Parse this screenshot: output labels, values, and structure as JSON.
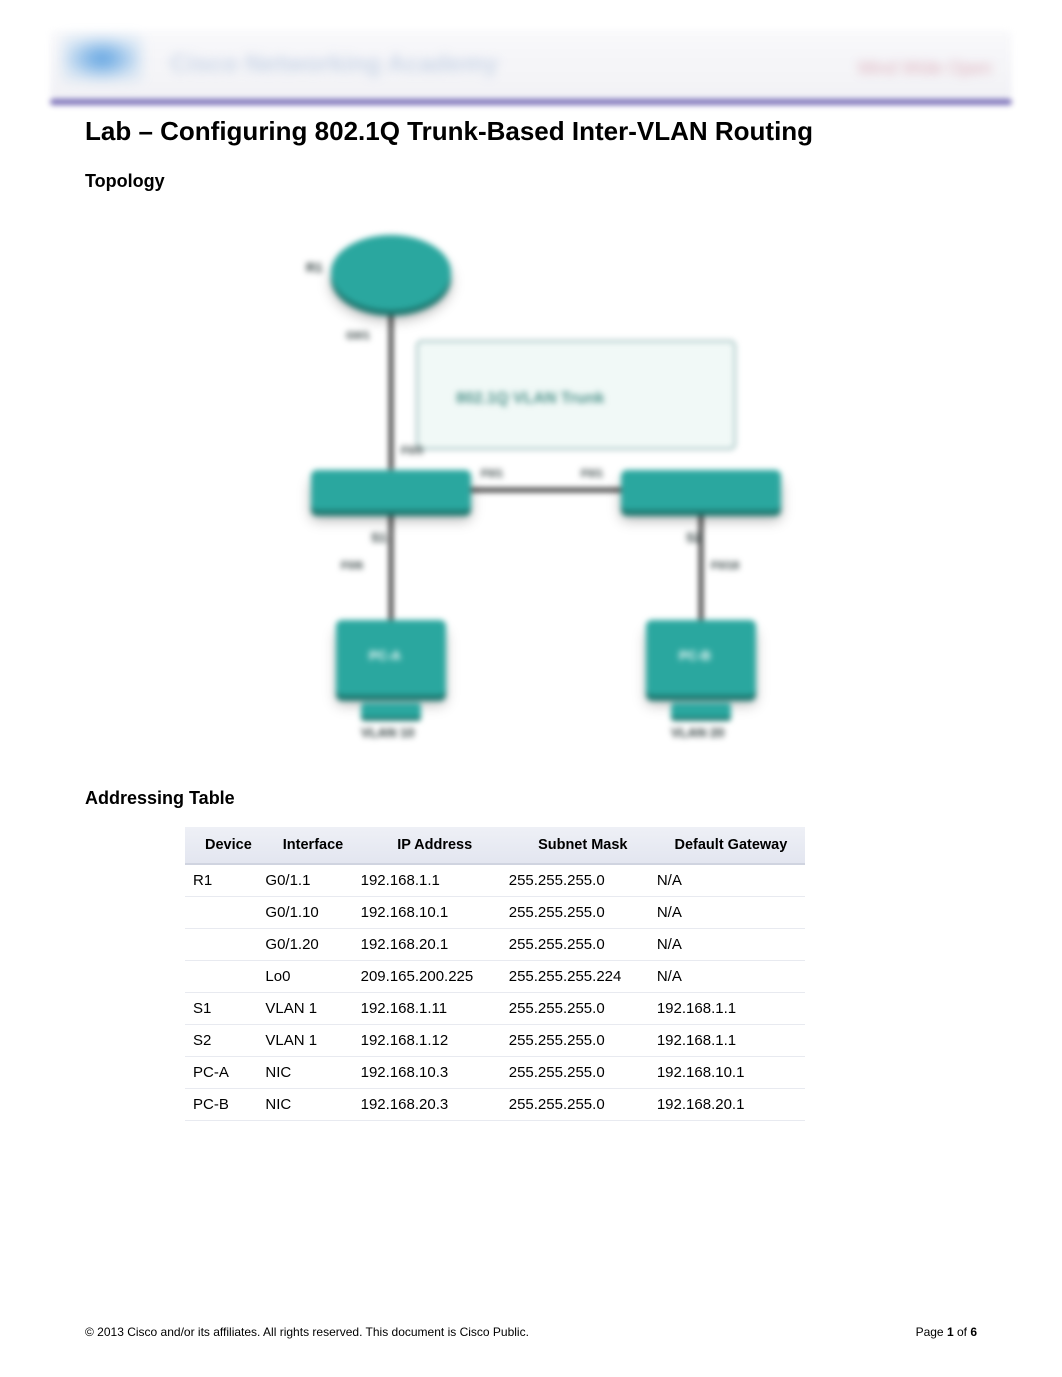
{
  "header": {
    "brand": "Cisco Networking Academy",
    "motto": "Mind Wide Open"
  },
  "title": "Lab – Configuring 802.1Q Trunk-Based Inter-VLAN Routing",
  "section_topology": "Topology",
  "section_addressing": "Addressing Table",
  "topology": {
    "devices": {
      "router": "R1",
      "switch1": "S1",
      "switch2": "S2",
      "pc_a": "PC-A",
      "pc_b": "PC-B"
    },
    "link_label": "802.1Q VLAN Trunk",
    "ports": {
      "r1_down": "G0/1",
      "s1_up": "F0/5",
      "s1_right": "F0/1",
      "s2_left": "F0/1",
      "s1_down": "F0/6",
      "s2_down": "F0/18"
    },
    "vlans": {
      "left": "VLAN 10",
      "right": "VLAN 20"
    }
  },
  "table": {
    "headers": {
      "device": "Device",
      "interface": "Interface",
      "ip": "IP Address",
      "mask": "Subnet Mask",
      "gateway": "Default Gateway"
    },
    "rows": [
      {
        "device": "R1",
        "interface": "G0/1.1",
        "ip": "192.168.1.1",
        "mask": "255.255.255.0",
        "gateway": "N/A"
      },
      {
        "device": "",
        "interface": "G0/1.10",
        "ip": "192.168.10.1",
        "mask": "255.255.255.0",
        "gateway": "N/A"
      },
      {
        "device": "",
        "interface": "G0/1.20",
        "ip": "192.168.20.1",
        "mask": "255.255.255.0",
        "gateway": "N/A"
      },
      {
        "device": "",
        "interface": "Lo0",
        "ip": "209.165.200.225",
        "mask": "255.255.255.224",
        "gateway": "N/A"
      },
      {
        "device": "S1",
        "interface": "VLAN 1",
        "ip": "192.168.1.11",
        "mask": "255.255.255.0",
        "gateway": "192.168.1.1"
      },
      {
        "device": "S2",
        "interface": "VLAN 1",
        "ip": "192.168.1.12",
        "mask": "255.255.255.0",
        "gateway": "192.168.1.1"
      },
      {
        "device": "PC-A",
        "interface": "NIC",
        "ip": "192.168.10.3",
        "mask": "255.255.255.0",
        "gateway": "192.168.10.1"
      },
      {
        "device": "PC-B",
        "interface": "NIC",
        "ip": "192.168.20.3",
        "mask": "255.255.255.0",
        "gateway": "192.168.20.1"
      }
    ]
  },
  "chart_data": {
    "type": "table",
    "title": "Addressing Table",
    "columns": [
      "Device",
      "Interface",
      "IP Address",
      "Subnet Mask",
      "Default Gateway"
    ],
    "rows": [
      [
        "R1",
        "G0/1.1",
        "192.168.1.1",
        "255.255.255.0",
        "N/A"
      ],
      [
        "R1",
        "G0/1.10",
        "192.168.10.1",
        "255.255.255.0",
        "N/A"
      ],
      [
        "R1",
        "G0/1.20",
        "192.168.20.1",
        "255.255.255.0",
        "N/A"
      ],
      [
        "R1",
        "Lo0",
        "209.165.200.225",
        "255.255.255.224",
        "N/A"
      ],
      [
        "S1",
        "VLAN 1",
        "192.168.1.11",
        "255.255.255.0",
        "192.168.1.1"
      ],
      [
        "S2",
        "VLAN 1",
        "192.168.1.12",
        "255.255.255.0",
        "192.168.1.1"
      ],
      [
        "PC-A",
        "NIC",
        "192.168.10.3",
        "255.255.255.0",
        "192.168.10.1"
      ],
      [
        "PC-B",
        "NIC",
        "192.168.20.3",
        "255.255.255.0",
        "192.168.20.1"
      ]
    ]
  },
  "footer": {
    "copyright": "© 2013 Cisco and/or its affiliates. All rights reserved. This document is Cisco Public.",
    "page_prefix": "Page ",
    "page_current": "1",
    "page_sep": " of ",
    "page_total": "6"
  }
}
